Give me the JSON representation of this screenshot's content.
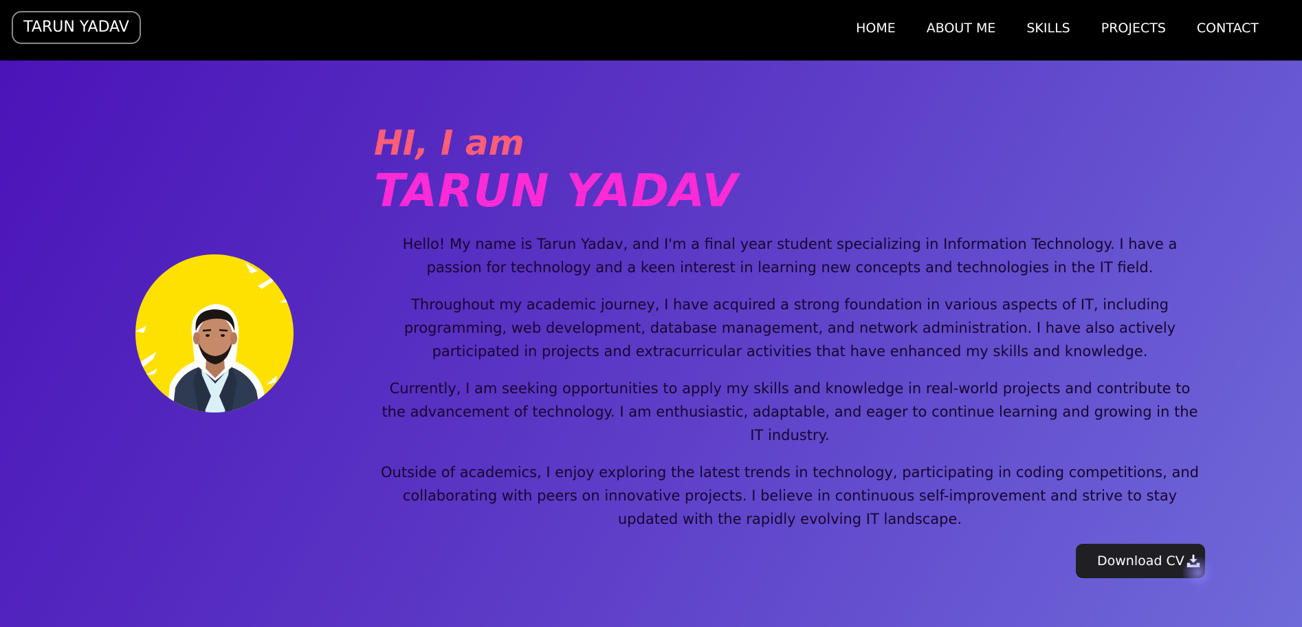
{
  "header": {
    "brand": "TARUN YADAV",
    "nav": [
      "HOME",
      "ABOUT ME",
      "SKILLS",
      "PROJECTS",
      "CONTACT"
    ]
  },
  "hero": {
    "greeting": "HI, I am",
    "name": "TARUN YADAV",
    "paragraphs": [
      "Hello! My name is Tarun Yadav, and I'm a final year student specializing in Information Technology. I have a passion for technology and a keen interest in learning new concepts and technologies in the IT field.",
      "Throughout my academic journey, I have acquired a strong foundation in various aspects of IT, including programming, web development, database management, and network administration. I have also actively participated in projects and extracurricular activities that have enhanced my skills and knowledge.",
      "Currently, I am seeking opportunities to apply my skills and knowledge in real-world projects and contribute to the advancement of technology. I am enthusiastic, adaptable, and eager to continue learning and growing in the IT industry.",
      "Outside of academics, I enjoy exploring the latest trends in technology, participating in coding competitions, and collaborating with peers on innovative projects. I believe in continuous self-improvement and strive to stay updated with the rapidly evolving IT landscape."
    ],
    "download_label": "Download CV",
    "download_icon": "download-icon"
  },
  "colors": {
    "navbar": "#000000",
    "background_start": "#4a12b8",
    "background_end": "#6f6ad9",
    "greeting": "#ff5d78",
    "name": "#ff2bd6",
    "avatar_bg": "#ffe100",
    "button": "#202024"
  }
}
